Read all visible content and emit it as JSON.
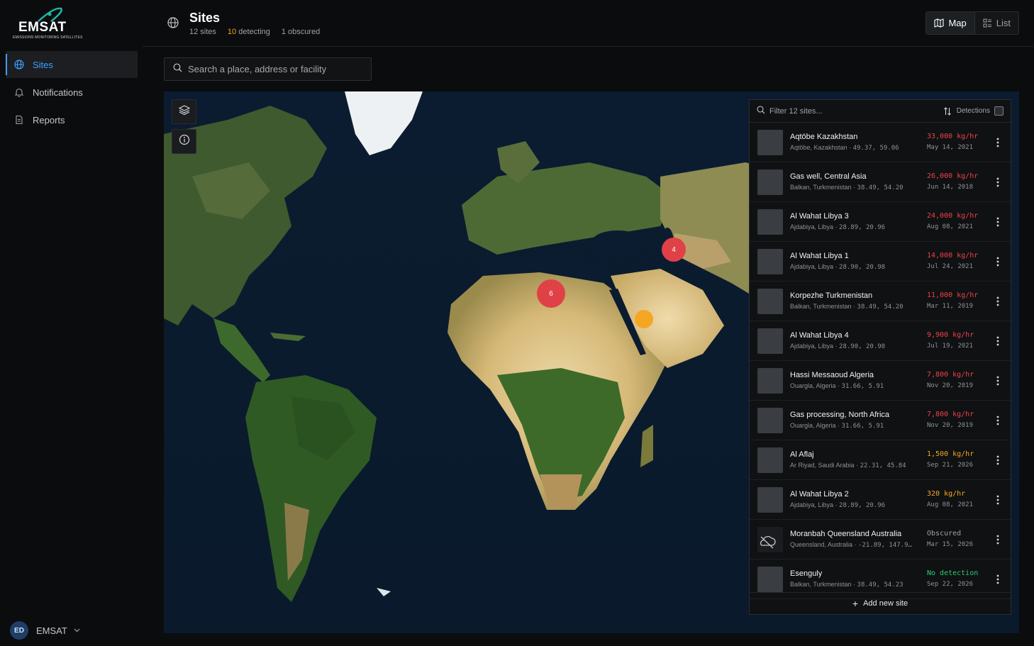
{
  "brand": {
    "name": "EMSAT",
    "tagline": "EMISSIONS MONITORING SATELLITES"
  },
  "nav": [
    {
      "label": "Sites",
      "icon": "globe-icon",
      "active": true
    },
    {
      "label": "Notifications",
      "icon": "bell-icon",
      "active": false
    },
    {
      "label": "Reports",
      "icon": "document-icon",
      "active": false
    }
  ],
  "user": {
    "initials": "ED",
    "name": "EMSAT"
  },
  "header": {
    "title": "Sites",
    "sites_count": "12 sites",
    "detecting_num": "10",
    "detecting_label": " detecting",
    "obscured": "1 obscured",
    "view_map": "Map",
    "view_list": "List"
  },
  "search": {
    "placeholder": "Search a place, address or facility"
  },
  "map": {
    "clusters": [
      {
        "label": "6",
        "color": "#e04146"
      },
      {
        "label": "4",
        "color": "#e04146"
      },
      {
        "label": "",
        "color": "#f5a623"
      }
    ]
  },
  "panel": {
    "filter_placeholder": "Filter 12 sites...",
    "detections_label": "Detections",
    "add_site": "Add new site"
  },
  "sites": [
    {
      "name": "Aqtöbe Kazakhstan",
      "region": "Aqtöbe, Kazakhstan",
      "coords": "49.37, 59.06",
      "rate": "33,000 kg/hr",
      "date": "May 14, 2021",
      "status": "high"
    },
    {
      "name": "Gas well, Central Asia",
      "region": "Balkan, Turkmenistan",
      "coords": "38.49, 54.20",
      "rate": "26,000 kg/hr",
      "date": "Jun 14, 2018",
      "status": "high"
    },
    {
      "name": "Al Wahat Libya 3",
      "region": "Ajdabiya, Libya",
      "coords": "28.89, 20.96",
      "rate": "24,000 kg/hr",
      "date": "Aug 08, 2021",
      "status": "high"
    },
    {
      "name": "Al Wahat Libya 1",
      "region": "Ajdabiya, Libya",
      "coords": "28.90, 20.98",
      "rate": "14,000 kg/hr",
      "date": "Jul 24, 2021",
      "status": "high"
    },
    {
      "name": "Korpezhe Turkmenistan",
      "region": "Balkan, Turkmenistan",
      "coords": "38.49, 54.20",
      "rate": "11,000 kg/hr",
      "date": "Mar 11, 2019",
      "status": "high"
    },
    {
      "name": "Al Wahat Libya 4",
      "region": "Ajdabiya, Libya",
      "coords": "28.90, 20.98",
      "rate": "9,900 kg/hr",
      "date": "Jul 19, 2021",
      "status": "high"
    },
    {
      "name": "Hassi Messaoud Algeria",
      "region": "Ouargla, Algeria",
      "coords": "31.66, 5.91",
      "rate": "7,800 kg/hr",
      "date": "Nov 20, 2019",
      "status": "high"
    },
    {
      "name": "Gas processing, North Africa",
      "region": "Ouargla, Algeria",
      "coords": "31.66, 5.91",
      "rate": "7,800 kg/hr",
      "date": "Nov 20, 2019",
      "status": "high"
    },
    {
      "name": "Al Aflaj",
      "region": "Ar Riyad, Saudi Arabia",
      "coords": "22.31, 45.84",
      "rate": "1,500 kg/hr",
      "date": "Sep 21, 2026",
      "status": "medium"
    },
    {
      "name": "Al Wahat Libya 2",
      "region": "Ajdabiya, Libya",
      "coords": "28.89, 20.96",
      "rate": "320 kg/hr",
      "date": "Aug 08, 2021",
      "status": "medium"
    },
    {
      "name": "Moranbah Queensland Australia",
      "region": "Queensland, Australia",
      "coords": "-21.89, 147.9…",
      "rate": "Obscured",
      "date": "Mar 15, 2026",
      "status": "obscured"
    },
    {
      "name": "Esenguly",
      "region": "Balkan, Turkmenistan",
      "coords": "38.49, 54.23",
      "rate": "No detection",
      "date": "Sep 22, 2026",
      "status": "none"
    }
  ],
  "colors": {
    "accent": "#3fa0ff",
    "high": "#ef4147",
    "medium": "#f5a623",
    "none": "#2ecc71",
    "obscured": "#9ea3a8"
  }
}
